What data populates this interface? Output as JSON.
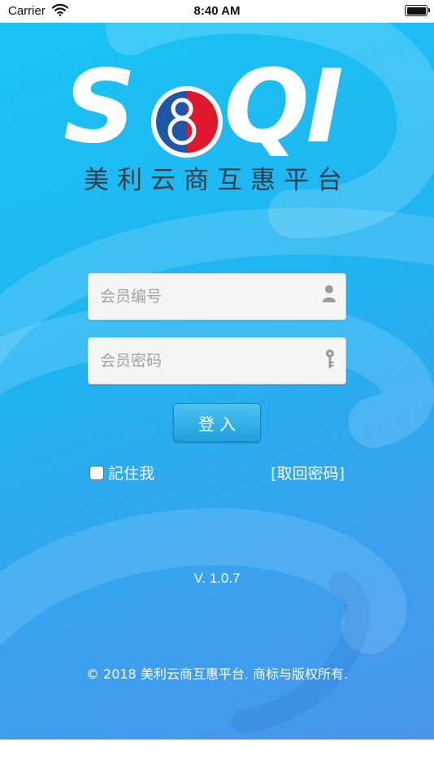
{
  "status_bar": {
    "carrier": "Carrier",
    "time": "8:40 AM",
    "icons": [
      "wifi-icon",
      "battery-icon"
    ]
  },
  "logo": {
    "letters_left": "S",
    "letters_right": "QI",
    "emblem_digit": "8",
    "subtitle": "美利云商互惠平台"
  },
  "login_form": {
    "member_id_placeholder": "会员编号",
    "member_id_value": "",
    "password_placeholder": "会员密码",
    "password_value": "",
    "member_id_icon": "user-icon",
    "password_icon": "key-icon",
    "login_label": "登入",
    "remember_label": "記住我",
    "remember_checked": false,
    "forgot_label": "[取回密码]"
  },
  "footer": {
    "version": "V. 1.0.7",
    "copyright": "© 2018 美利云商互惠平台. 商标与版权所有."
  },
  "colors": {
    "background_top": "#19c4f5",
    "background_bottom": "#4a94ec",
    "emblem_red": "#e0182d",
    "emblem_blue": "#1f56a5",
    "subtitle": "#333d48"
  }
}
